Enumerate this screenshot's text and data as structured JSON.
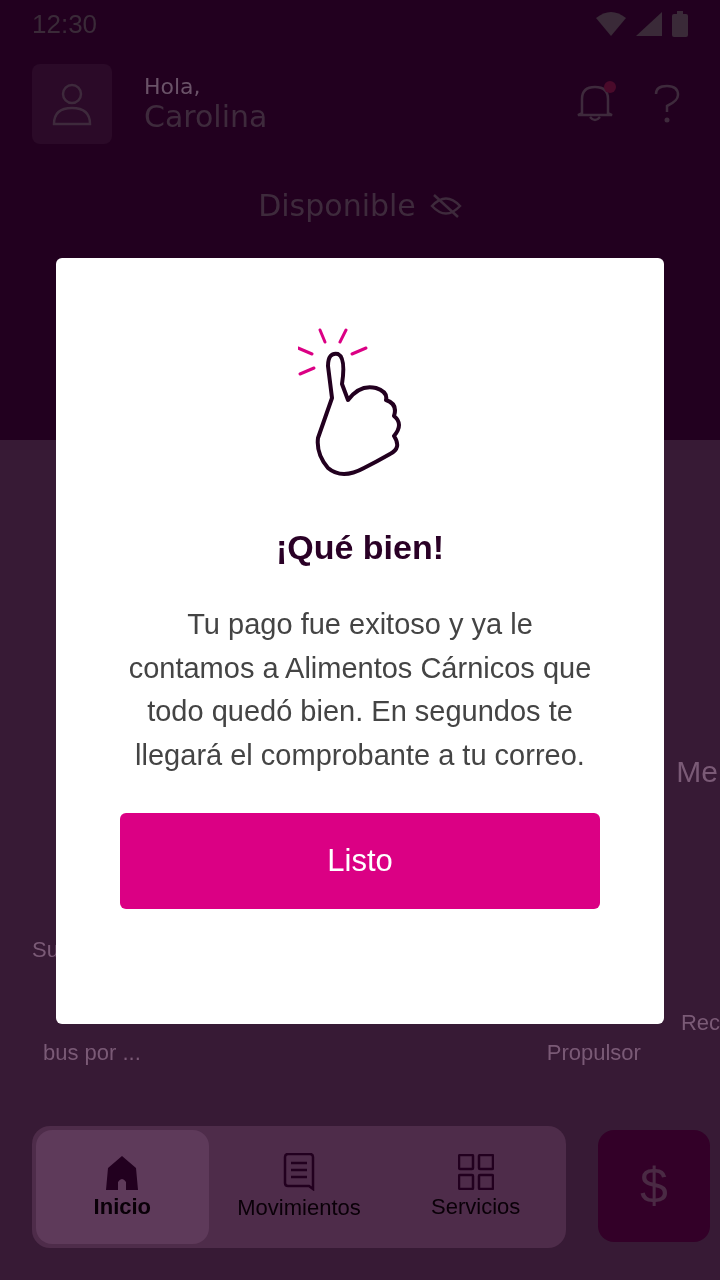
{
  "status_bar": {
    "time": "12:30"
  },
  "header": {
    "greeting": "Hola,",
    "name": "Carolina",
    "has_notification": true
  },
  "balance": {
    "label": "Disponible"
  },
  "background_fragments": {
    "left": [
      "Su",
      "bus por ..."
    ],
    "right_col": [
      "Propulsor"
    ],
    "edge": [
      "Me",
      "Rec"
    ]
  },
  "bottom_nav": [
    {
      "label": "Inicio",
      "selected": true
    },
    {
      "label": "Movimientos",
      "selected": false
    },
    {
      "label": "Servicios",
      "selected": false
    }
  ],
  "pay_button": {
    "symbol": "$"
  },
  "dialog": {
    "title": "¡Qué bien!",
    "message": "Tu pago fue exitoso y ya le contamos a Alimentos Cárnicos que todo quedó bien. En segundos te llegará el comprobante a tu correo.",
    "button": "Listo"
  }
}
